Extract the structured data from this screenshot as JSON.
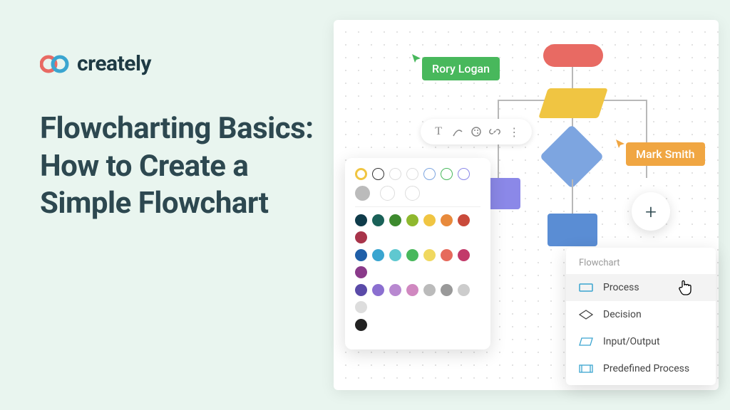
{
  "brand": {
    "name": "creately"
  },
  "headline": "Flowcharting Basics: How to Create a Simple Flowchart",
  "collab": {
    "user1": "Rory Logan",
    "user2": "Mark Smith"
  },
  "toolbar": {
    "items": [
      "text",
      "pencil",
      "palette",
      "link",
      "more"
    ]
  },
  "palette": {
    "outline_colors": [
      "#f0c542",
      "#333",
      "#fff",
      "#fff",
      "#7da5e0",
      "#48b85c",
      "#8b88e8"
    ],
    "stroke_widths": [
      "thin",
      "med",
      "thick"
    ],
    "fill_groups": [
      [
        "#0f3b4a",
        "#1a6158",
        "#3d8a2e",
        "#8fb82e",
        "#f0c542",
        "#e88a3c",
        "#c94a3b",
        "#a8344a"
      ],
      [
        "#1f5fa8",
        "#3aa5d0",
        "#5fc8d0",
        "#48b85c",
        "#f0d860",
        "#e66a5c",
        "#c23a6a",
        "#8a3a8a"
      ],
      [
        "#5a4aa8",
        "#8b6fd0",
        "#b888d0",
        "#d088c0",
        "#bbb",
        "#999",
        "#ccc",
        "#ddd"
      ],
      [
        "#222"
      ]
    ]
  },
  "menu": {
    "title": "Flowchart",
    "items": [
      {
        "label": "Process",
        "icon": "process",
        "hover": true
      },
      {
        "label": "Decision",
        "icon": "decision",
        "hover": false
      },
      {
        "label": "Input/Output",
        "icon": "io",
        "hover": false
      },
      {
        "label": "Predefined Process",
        "icon": "predefined",
        "hover": false
      }
    ]
  },
  "shapes": {
    "start": "terminator",
    "input": "parallelogram",
    "decision": "diamond",
    "proc1": "rect",
    "proc2": "rect"
  }
}
